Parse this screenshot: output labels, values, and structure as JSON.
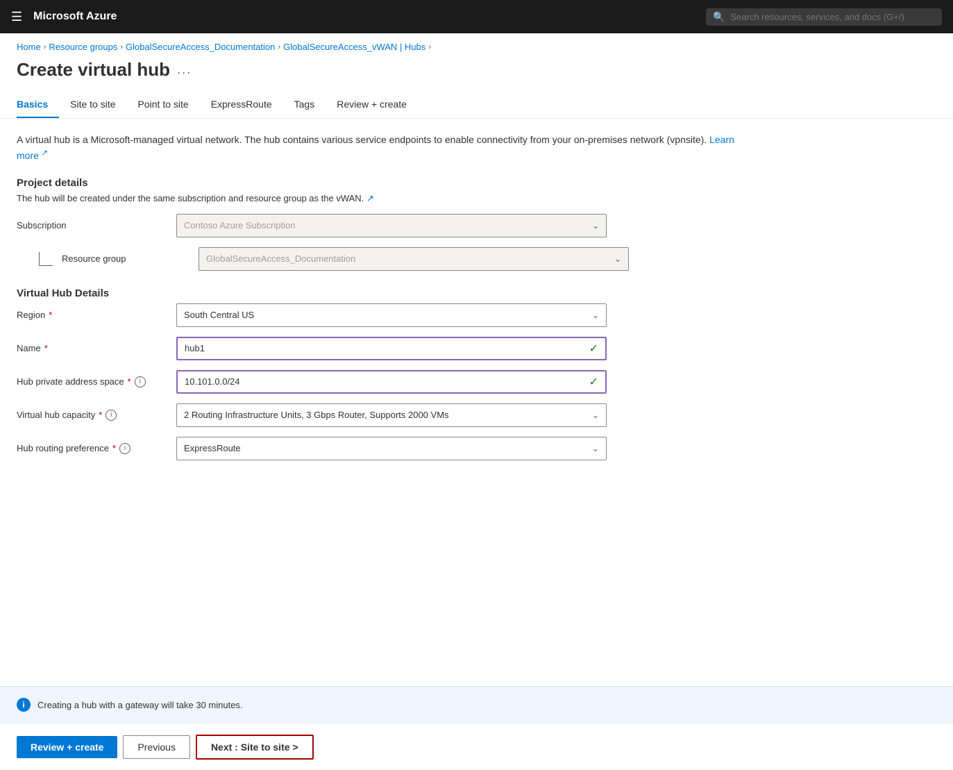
{
  "navbar": {
    "brand": "Microsoft Azure",
    "search_placeholder": "Search resources, services, and docs (G+/)"
  },
  "breadcrumb": {
    "items": [
      {
        "label": "Home",
        "href": "#"
      },
      {
        "label": "Resource groups",
        "href": "#"
      },
      {
        "label": "GlobalSecureAccess_Documentation",
        "href": "#"
      },
      {
        "label": "GlobalSecureAccess_vWAN | Hubs",
        "href": "#"
      }
    ]
  },
  "page": {
    "title": "Create virtual hub",
    "dots": "..."
  },
  "tabs": [
    {
      "label": "Basics",
      "active": true
    },
    {
      "label": "Site to site",
      "active": false
    },
    {
      "label": "Point to site",
      "active": false
    },
    {
      "label": "ExpressRoute",
      "active": false
    },
    {
      "label": "Tags",
      "active": false
    },
    {
      "label": "Review + create",
      "active": false
    }
  ],
  "description": {
    "text": "A virtual hub is a Microsoft-managed virtual network. The hub contains various service endpoints to enable connectivity from your on-premises network (vpnsite).",
    "learn_more": "Learn more"
  },
  "project_details": {
    "header": "Project details",
    "sub_text": "The hub will be created under the same subscription and resource group as the vWAN.",
    "sub_link_icon": "↗",
    "subscription_label": "Subscription",
    "subscription_value": "Contoso Azure Subscription",
    "resource_group_label": "Resource group",
    "resource_group_value": "GlobalSecureAccess_Documentation"
  },
  "hub_details": {
    "header": "Virtual Hub Details",
    "region_label": "Region",
    "region_value": "South Central US",
    "name_label": "Name",
    "name_value": "hub1",
    "address_space_label": "Hub private address space",
    "address_space_value": "10.101.0.0/24",
    "capacity_label": "Virtual hub capacity",
    "capacity_value": "2 Routing Infrastructure Units, 3 Gbps Router, Supports 2000 VMs",
    "routing_label": "Hub routing preference",
    "routing_value": "ExpressRoute"
  },
  "info_bar": {
    "message": "Creating a hub with a gateway will take 30 minutes."
  },
  "footer": {
    "review_create": "Review + create",
    "previous": "Previous",
    "next": "Next : Site to site >"
  }
}
